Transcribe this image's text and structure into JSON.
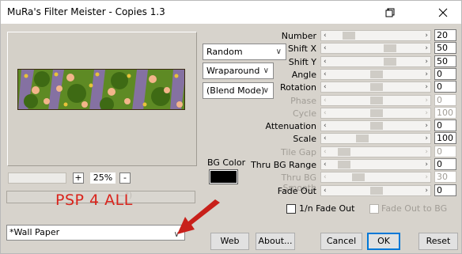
{
  "window": {
    "title": "MuRa's Filter Meister - Copies 1.3"
  },
  "preview": {
    "zoom": "25%",
    "zoom_minus": "-",
    "zoom_plus": "+",
    "progress_hint": "—”)",
    "overlay_text": "PSP 4 ALL"
  },
  "preset": {
    "value": "*Wall Paper"
  },
  "combos": {
    "mode": "Random",
    "edge": "Wraparound",
    "blend": "(Blend Mode)"
  },
  "bgcolor": {
    "label": "BG Color",
    "color": "#000000"
  },
  "sliders": [
    {
      "label": "Number",
      "value": "20",
      "level": 0.12,
      "enabled": true
    },
    {
      "label": "Shift X",
      "value": "50",
      "level": 0.68,
      "enabled": true
    },
    {
      "label": "Shift Y",
      "value": "50",
      "level": 0.68,
      "enabled": true
    },
    {
      "label": "Angle",
      "value": "0",
      "level": 0.5,
      "enabled": true
    },
    {
      "label": "Rotation",
      "value": "0",
      "level": 0.5,
      "enabled": true
    },
    {
      "label": "Phase",
      "value": "0",
      "level": 0.5,
      "enabled": false
    },
    {
      "label": "Cycle",
      "value": "100",
      "level": 0.5,
      "enabled": false
    },
    {
      "label": "Attenuation",
      "value": "0",
      "level": 0.5,
      "enabled": true
    },
    {
      "label": "Scale",
      "value": "100",
      "level": 0.3,
      "enabled": true
    },
    {
      "label": "Tile Gap",
      "value": "0",
      "level": 0.05,
      "enabled": false
    },
    {
      "label": "Thru BG Range",
      "value": "0",
      "level": 0.05,
      "enabled": true
    },
    {
      "label": "Thru BG Smooth",
      "value": "30",
      "level": 0.25,
      "enabled": false
    },
    {
      "label": "Fade Out",
      "value": "0",
      "level": 0.5,
      "enabled": true
    }
  ],
  "checks": {
    "fade_1n": "1/n Fade Out",
    "fade_bg": "Fade Out to BG"
  },
  "buttons": {
    "web": "Web",
    "about": "About...",
    "cancel": "Cancel",
    "ok": "OK",
    "reset": "Reset"
  },
  "colors": {
    "accent": "#0078d7",
    "overlay": "#d9241c",
    "arrow": "#c8201a"
  }
}
